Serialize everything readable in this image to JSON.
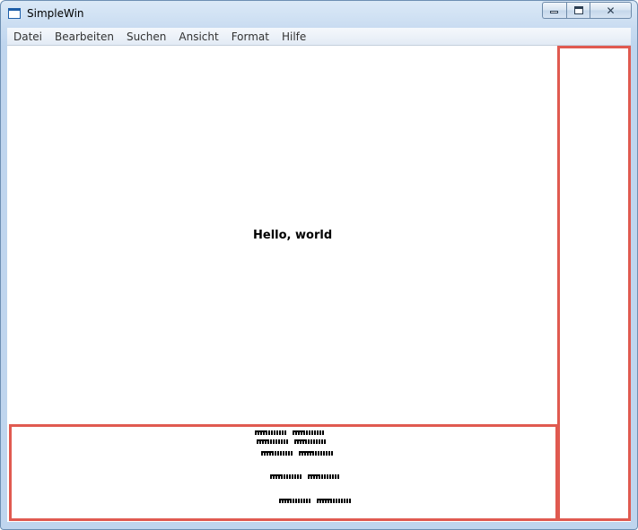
{
  "window": {
    "title": "SimpleWin",
    "close_glyph": "✕"
  },
  "menubar": {
    "items": [
      "Datei",
      "Bearbeiten",
      "Suchen",
      "Ansicht",
      "Format",
      "Hilfe"
    ]
  },
  "content": {
    "main_text": "Hello, world"
  },
  "colors": {
    "pane_border": "#e05a50",
    "title_bar": "#c9dcf1"
  },
  "icons": {
    "app": "window-icon",
    "minimize": "minimize-icon",
    "maximize": "maximize-icon",
    "close": "close-icon"
  }
}
